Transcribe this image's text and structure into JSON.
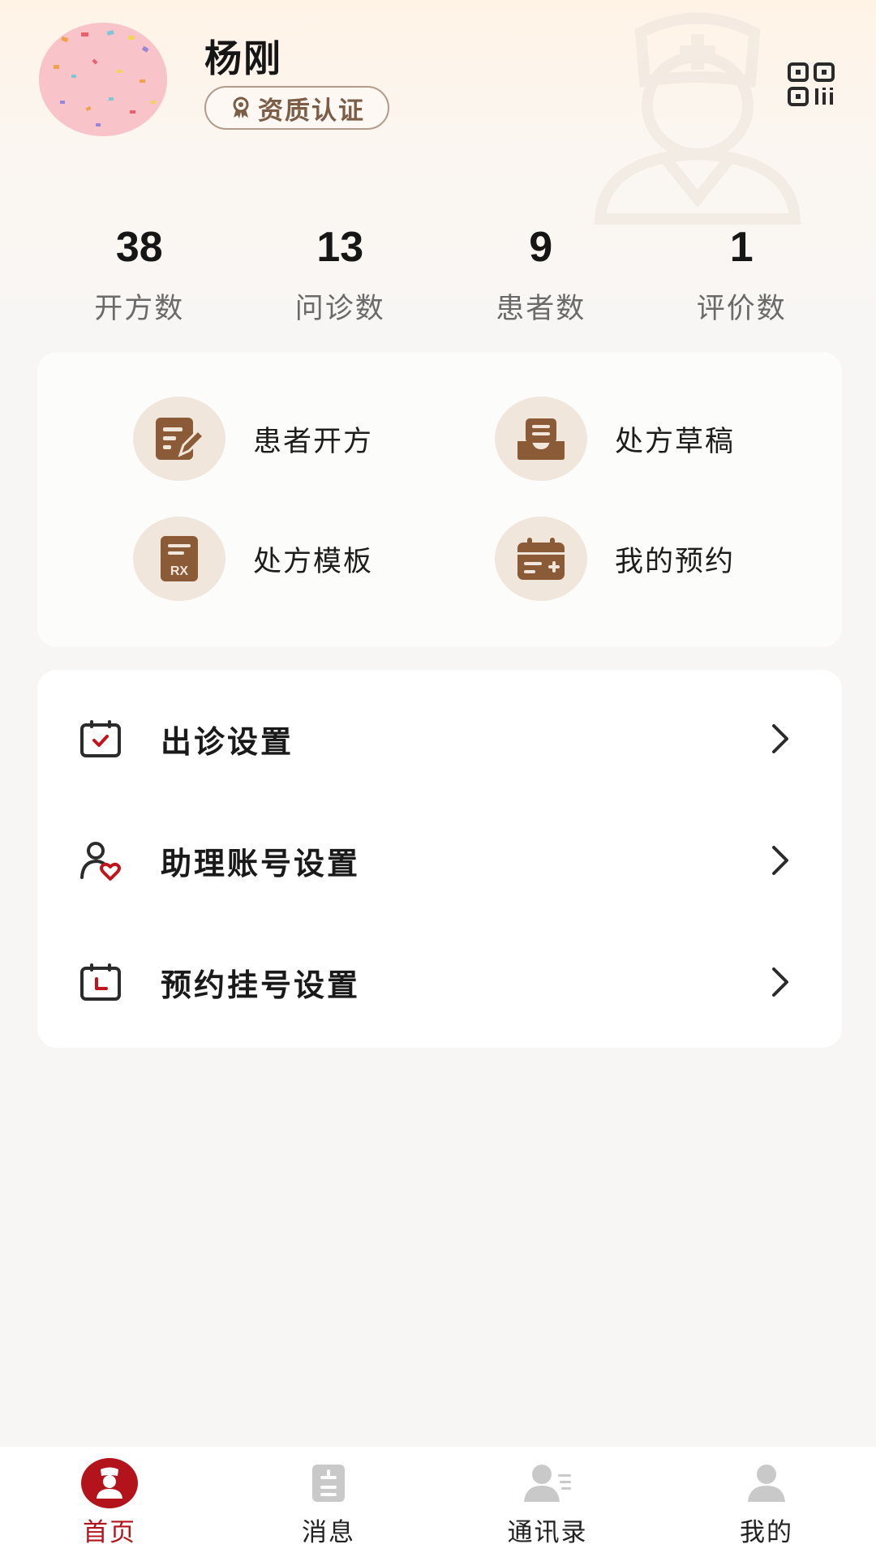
{
  "profile": {
    "name": "杨刚",
    "certification_label": "资质认证",
    "avatar": "confetti-avatar",
    "qr_icon": "qr-code-icon"
  },
  "stats": [
    {
      "value": "38",
      "label": "开方数"
    },
    {
      "value": "13",
      "label": "问诊数"
    },
    {
      "value": "9",
      "label": "患者数"
    },
    {
      "value": "1",
      "label": "评价数"
    }
  ],
  "quick_actions": [
    {
      "label": "患者开方",
      "icon": "prescribe-pen-icon"
    },
    {
      "label": "处方草稿",
      "icon": "draft-inbox-icon"
    },
    {
      "label": "处方模板",
      "icon": "rx-template-icon"
    },
    {
      "label": "我的预约",
      "icon": "calendar-add-icon"
    }
  ],
  "settings": [
    {
      "label": "出诊设置",
      "icon": "calendar-check-icon"
    },
    {
      "label": "助理账号设置",
      "icon": "assistant-heart-icon"
    },
    {
      "label": "预约挂号设置",
      "icon": "calendar-clock-icon"
    }
  ],
  "nav": [
    {
      "label": "首页",
      "icon": "doctor-home-icon",
      "active": true
    },
    {
      "label": "消息",
      "icon": "message-note-icon",
      "active": false
    },
    {
      "label": "通讯录",
      "icon": "contacts-icon",
      "active": false
    },
    {
      "label": "我的",
      "icon": "person-icon",
      "active": false
    }
  ],
  "colors": {
    "accent_red": "#b3141c",
    "brown_icon": "#8a5b36",
    "icon_bg": "#f1e6dc",
    "badge_text": "#7b5e45"
  }
}
